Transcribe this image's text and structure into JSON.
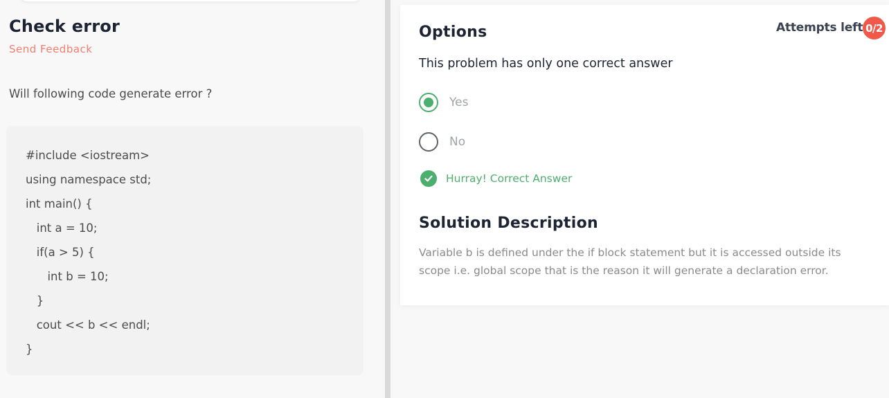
{
  "problem": {
    "title": "Check error",
    "feedback_label": "Send Feedback",
    "question": "Will following code generate error ?",
    "code_lines": [
      "#include <iostream>",
      "using namespace std;",
      "int main() {",
      "   int a = 10;",
      "   if(a > 5) {",
      "      int b = 10;",
      "   }",
      "   cout << b << endl;",
      "}"
    ]
  },
  "options_panel": {
    "title": "Options",
    "attempts_label": "Attempts left:",
    "attempts_value": "0/2",
    "instruction": "This problem has only one correct answer",
    "options": [
      {
        "label": "Yes",
        "selected": true
      },
      {
        "label": "No",
        "selected": false
      }
    ],
    "result_message": "Hurray! Correct Answer",
    "solution_title": "Solution Description",
    "solution_text": "Variable b is defined under the if block statement but it is accessed outside its scope i.e. global scope that is the reason it will generate a declaration error."
  },
  "colors": {
    "accent_red": "#f0584a",
    "feedback_pink": "#f47c6e",
    "success_green": "#4caf6e"
  }
}
